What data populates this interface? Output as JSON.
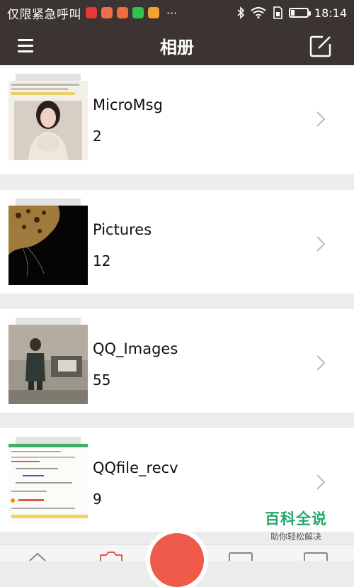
{
  "status_bar": {
    "carrier_text": "仅限紧急呼叫",
    "time": "18:14",
    "overflow": "···",
    "app_icon_colors": [
      "#e53935",
      "#f06f4a",
      "#f36b3b",
      "#2ec44c",
      "#f2a32b"
    ]
  },
  "header": {
    "title": "相册",
    "menu_icon": "hamburger-menu-icon",
    "edit_icon": "edit-icon",
    "bg_color": "#3b3432"
  },
  "albums": [
    {
      "name": "MicroMsg",
      "count": "2"
    },
    {
      "name": "Pictures",
      "count": "12"
    },
    {
      "name": "QQ_Images",
      "count": "55"
    },
    {
      "name": "QQfile_recv",
      "count": "9"
    }
  ],
  "watermark": {
    "main": "百科全说",
    "sub": "助你轻松解决",
    "color": "#21a96a"
  },
  "fab_color": "#ef5a4a"
}
